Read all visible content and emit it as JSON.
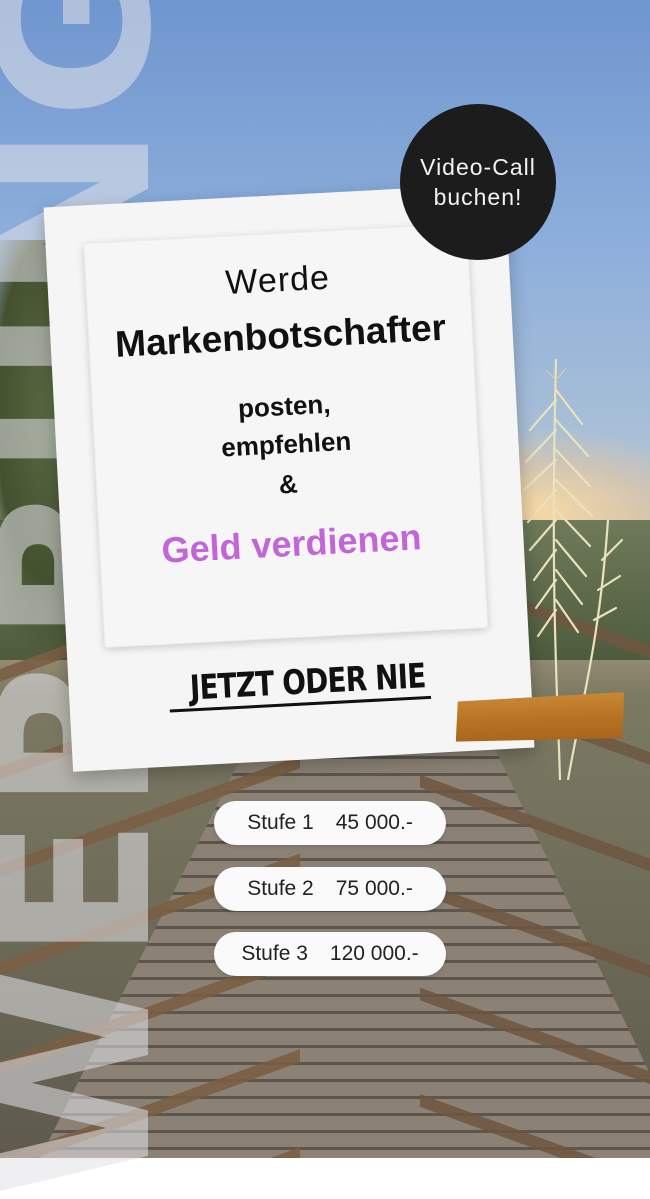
{
  "background_text": "WERBUNG",
  "card": {
    "line1": "Werde",
    "line2": "Markenbotschafter",
    "line3": "posten,",
    "line4": "empfehlen",
    "line5": "&",
    "line6": "Geld verdienen",
    "cta": "JETZT ODER NIE"
  },
  "badge": {
    "line1": "Video-Call",
    "line2": "buchen!"
  },
  "tiers": [
    {
      "label": "Stufe 1",
      "amount": "45 000.-"
    },
    {
      "label": "Stufe 2",
      "amount": "75 000.-"
    },
    {
      "label": "Stufe 3",
      "amount": "120 000.-"
    }
  ],
  "colors": {
    "accent": "#c165d9",
    "badge_bg": "#1c1c1c",
    "tape": "#b87424"
  }
}
